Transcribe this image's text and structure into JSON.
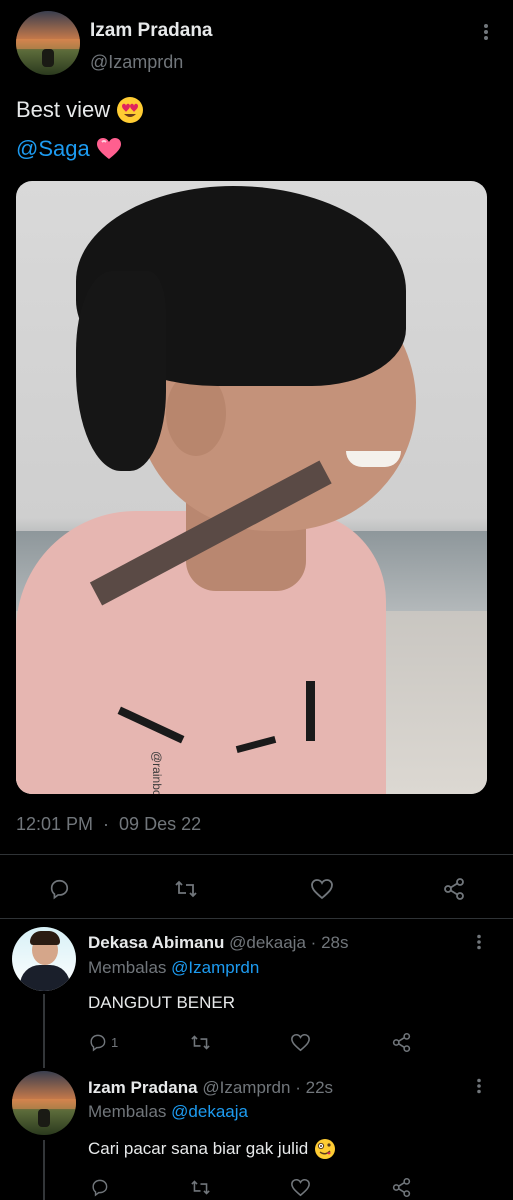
{
  "tweet": {
    "author_name": "Izam Pradana",
    "author_handle": "@Izamprdn",
    "text_line1": "Best view",
    "mention": "@Saga",
    "time": "12:01 PM",
    "date": "09 Des 22",
    "separator": "·",
    "image_watermark": "@rainbownsmiles"
  },
  "replies": [
    {
      "name": "Dekasa Abimanu",
      "handle": "@dekaaja",
      "dot": "·",
      "age": "28s",
      "replying_label": "Membalas",
      "replying_to": "@Izamprdn",
      "text": "DANGDUT BENER",
      "reply_count": "1"
    },
    {
      "name": "Izam Pradana",
      "handle": "@Izamprdn",
      "dot": "·",
      "age": "22s",
      "replying_label": "Membalas",
      "replying_to": "@dekaaja",
      "text": "Cari pacar sana biar gak julid"
    }
  ],
  "colors": {
    "background": "#000000",
    "text": "#e7e9ea",
    "secondary": "#71767b",
    "link": "#1d9bf0"
  },
  "icons": [
    "more-icon",
    "heart-eyes-emoji",
    "pink-heart-emoji",
    "reply-icon",
    "retweet-icon",
    "like-icon",
    "share-icon",
    "zany-face-emoji"
  ]
}
